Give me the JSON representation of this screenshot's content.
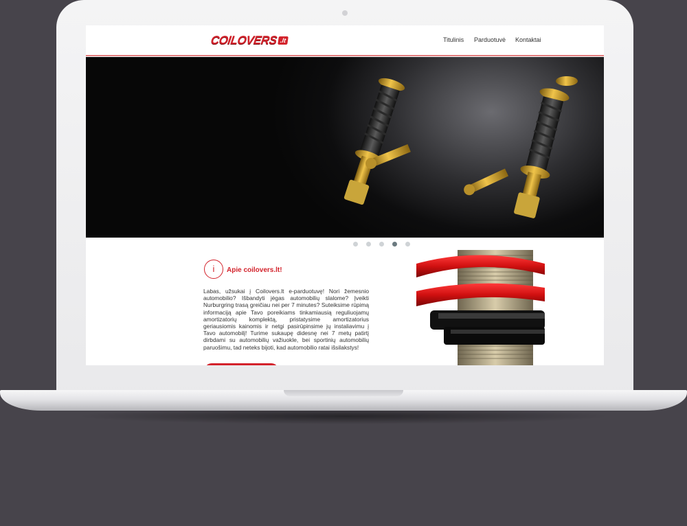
{
  "site": {
    "logo_text": "COILOVERS",
    "logo_badge": ".lt"
  },
  "nav": {
    "items": [
      "Titulinis",
      "Parduotuvė",
      "Kontaktai"
    ]
  },
  "slider": {
    "dot_count": 5,
    "active_index": 3
  },
  "about": {
    "icon_glyph": "i",
    "title": "Apie coilovers.lt!",
    "text": "Labas, užsukai į Coilovers.lt e-parduotuvę! Nori žemesnio automobilio? Išbandyti jėgas automobilių slalome? Įveikti Nurburgring trasą greičiau nei per 7 minutes? Suteiksime rūpimą informaciją apie Tavo poreikiams tinkamiausią reguliuojamų amortizatorių komplektą, pristatysime amortizatorius geriausiomis kainomis ir netgi pasirūpinsime jų instaliavimu į Tavo automobilį! Turime sukaupę didesnę nei 7 metų patirtį dirbdami su automobilių važiuokle, bei sportinių automobilių paruošimu, tad neteks bijoti, kad automobilio ratai išsilakstys!"
  },
  "colors": {
    "accent": "#d3222b",
    "background": "#47444b",
    "header_line": "#e27d7e"
  }
}
